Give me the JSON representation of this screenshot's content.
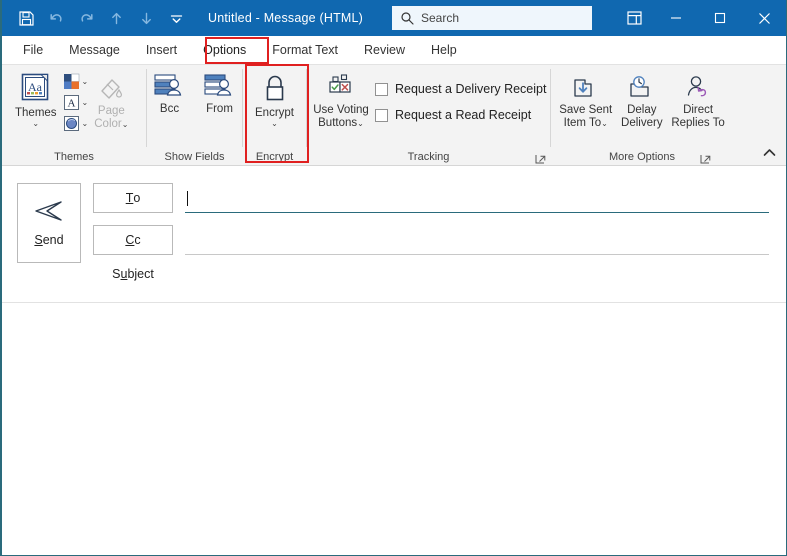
{
  "titlebar": {
    "document_title": "Untitled  -  Message (HTML)",
    "quick_access": [
      {
        "name": "save-icon",
        "label": "Save",
        "enabled": true
      },
      {
        "name": "undo-icon",
        "label": "Undo",
        "enabled": false
      },
      {
        "name": "redo-icon",
        "label": "Redo",
        "enabled": false
      },
      {
        "name": "previous-item-icon",
        "label": "Previous Item",
        "enabled": false
      },
      {
        "name": "next-item-icon",
        "label": "Next Item",
        "enabled": false
      },
      {
        "name": "customize-quick-access-toolbar-icon",
        "label": "Customize Quick Access Toolbar",
        "enabled": true
      }
    ],
    "search_placeholder": "Search",
    "window_controls": {
      "ribbon_display_options": "Ribbon Display Options",
      "minimize": "Minimize",
      "maximize": "Maximize",
      "close": "Close"
    },
    "colors": {
      "bar": "#1068b0",
      "search_bg": "#eff6fc"
    }
  },
  "tabs": [
    {
      "label": "File",
      "active": false,
      "highlighted": false
    },
    {
      "label": "Message",
      "active": false,
      "highlighted": false
    },
    {
      "label": "Insert",
      "active": false,
      "highlighted": false
    },
    {
      "label": "Options",
      "active": true,
      "highlighted": true
    },
    {
      "label": "Format Text",
      "active": false,
      "highlighted": false
    },
    {
      "label": "Review",
      "active": false,
      "highlighted": false
    },
    {
      "label": "Help",
      "active": false,
      "highlighted": false
    }
  ],
  "ribbon": {
    "groups": [
      {
        "name": "themes",
        "label": "Themes",
        "buttons": [
          {
            "name": "themes-button",
            "label": "Themes",
            "icon": "themes-aa-icon",
            "has_dropdown": true,
            "disabled": false
          },
          {
            "name": "theme-colors-button",
            "label": "Colors",
            "icon": "color-palette-icon",
            "has_dropdown": true,
            "disabled": false
          },
          {
            "name": "theme-fonts-button",
            "label": "Fonts",
            "icon": "font-a-icon",
            "has_dropdown": true,
            "disabled": false
          },
          {
            "name": "theme-effects-button",
            "label": "Effects",
            "icon": "effects-circle-icon",
            "has_dropdown": true,
            "disabled": false
          },
          {
            "name": "page-color-button",
            "label": "Page Color",
            "icon": "paint-bucket-icon",
            "has_dropdown": true,
            "disabled": true
          }
        ]
      },
      {
        "name": "show-fields",
        "label": "Show Fields",
        "buttons": [
          {
            "name": "bcc-button",
            "label": "Bcc",
            "icon": "bcc-field-icon",
            "has_dropdown": false,
            "disabled": false
          },
          {
            "name": "from-button",
            "label": "From",
            "icon": "from-field-icon",
            "has_dropdown": false,
            "disabled": false
          }
        ]
      },
      {
        "name": "encrypt",
        "label": "Encrypt",
        "highlighted": true,
        "buttons": [
          {
            "name": "encrypt-button",
            "label": "Encrypt",
            "icon": "padlock-icon",
            "has_dropdown": true,
            "disabled": false
          }
        ]
      },
      {
        "name": "tracking",
        "label": "Tracking",
        "has_dialog_launcher": true,
        "buttons": [
          {
            "name": "use-voting-buttons-button",
            "label": "Use Voting\nButtons",
            "icon": "voting-buttons-icon",
            "has_dropdown": true,
            "disabled": false
          }
        ],
        "checkboxes": [
          {
            "name": "request-delivery-receipt-checkbox",
            "label": "Request a Delivery Receipt",
            "checked": false
          },
          {
            "name": "request-read-receipt-checkbox",
            "label": "Request a Read Receipt",
            "checked": false
          }
        ]
      },
      {
        "name": "more-options",
        "label": "More Options",
        "has_dialog_launcher": true,
        "buttons": [
          {
            "name": "save-sent-item-to-button",
            "label": "Save Sent\nItem To",
            "icon": "save-sent-item-icon",
            "has_dropdown": true,
            "disabled": false
          },
          {
            "name": "delay-delivery-button",
            "label": "Delay\nDelivery",
            "icon": "delay-delivery-clock-icon",
            "has_dropdown": false,
            "disabled": false
          },
          {
            "name": "direct-replies-to-button",
            "label": "Direct\nReplies To",
            "icon": "direct-replies-person-icon",
            "has_dropdown": false,
            "disabled": false
          }
        ]
      }
    ],
    "collapse_label": "Collapse the Ribbon",
    "labels": {
      "themes": "Themes",
      "themes_btn": "Themes",
      "page_color": "Page\nColor",
      "page_color_line1": "Page",
      "page_color_line2": "Color",
      "show_fields": "Show Fields",
      "bcc": "Bcc",
      "from": "From",
      "encrypt_group": "Encrypt",
      "encrypt_btn": "Encrypt",
      "tracking": "Tracking",
      "voting_line1": "Use Voting",
      "voting_line2": "Buttons",
      "delivery_receipt": "Request a Delivery Receipt",
      "read_receipt": "Request a Read Receipt",
      "more_options": "More Options",
      "save_sent_line1": "Save Sent",
      "save_sent_line2": "Item To",
      "delay_line1": "Delay",
      "delay_line2": "Delivery",
      "direct_line1": "Direct",
      "direct_line2": "Replies To"
    }
  },
  "compose": {
    "send_label": "Send",
    "to_label": "To",
    "cc_label": "Cc",
    "subject_label": "Subject",
    "to_value": "",
    "cc_value": "",
    "subject_value": "",
    "body_value": "",
    "focused_field": "to"
  },
  "highlights": {
    "color": "#e02020",
    "targets": [
      "Options",
      "Encrypt"
    ]
  }
}
